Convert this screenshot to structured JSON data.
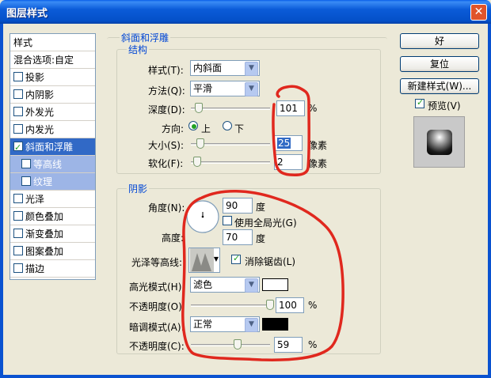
{
  "window": {
    "title": "图层样式",
    "close_glyph": "✕"
  },
  "sidebar": {
    "header": "样式",
    "items": [
      {
        "label": "混合选项:自定",
        "checkbox": false
      },
      {
        "label": "投影",
        "checkbox": true,
        "checked": false
      },
      {
        "label": "内阴影",
        "checkbox": true,
        "checked": false
      },
      {
        "label": "外发光",
        "checkbox": true,
        "checked": false
      },
      {
        "label": "内发光",
        "checkbox": true,
        "checked": false
      },
      {
        "label": "斜面和浮雕",
        "checkbox": true,
        "checked": true,
        "selected": true
      },
      {
        "label": "等高线",
        "checkbox": true,
        "checked": false,
        "sub": true
      },
      {
        "label": "纹理",
        "checkbox": true,
        "checked": false,
        "sub": true
      },
      {
        "label": "光泽",
        "checkbox": true,
        "checked": false
      },
      {
        "label": "颜色叠加",
        "checkbox": true,
        "checked": false
      },
      {
        "label": "渐变叠加",
        "checkbox": true,
        "checked": false
      },
      {
        "label": "图案叠加",
        "checkbox": true,
        "checked": false
      },
      {
        "label": "描边",
        "checkbox": true,
        "checked": false
      }
    ]
  },
  "bevel": {
    "title": "斜面和浮雕",
    "structure": {
      "title": "结构",
      "style_label": "样式(T):",
      "style_value": "内斜面",
      "technique_label": "方法(Q):",
      "technique_value": "平滑",
      "depth_label": "深度(D):",
      "depth_value": "101",
      "depth_unit": "%",
      "direction_label": "方向:",
      "dir_up": "上",
      "dir_down": "下",
      "size_label": "大小(S):",
      "size_value": "25",
      "size_unit": "像素",
      "soften_label": "软化(F):",
      "soften_value": "2",
      "soften_unit": "像素",
      "depth_level_pct": 10,
      "size_level_pct": 12,
      "soften_level_pct": 8
    },
    "shading": {
      "title": "阴影",
      "angle_label": "角度(N):",
      "angle_value": "90",
      "angle_unit": "度",
      "global_light_label": "使用全局光(G)",
      "altitude_label": "高度:",
      "altitude_value": "70",
      "altitude_unit": "度",
      "gloss_label": "光泽等高线:",
      "antialias_label": "消除锯齿(L)",
      "highlight_mode_label": "高光模式(H):",
      "highlight_mode_value": "滤色",
      "highlight_color": "#ffffff",
      "highlight_opacity_label": "不透明度(O):",
      "highlight_opacity_value": "100",
      "highlight_opacity_unit": "%",
      "shadow_mode_label": "暗调模式(A):",
      "shadow_mode_value": "正常",
      "shadow_color": "#000000",
      "shadow_opacity_label": "不透明度(C):",
      "shadow_opacity_value": "59",
      "shadow_opacity_unit": "%",
      "highlight_opacity_level_pct": 100,
      "shadow_opacity_level_pct": 59
    }
  },
  "buttons": {
    "ok": "好",
    "reset": "复位",
    "new_style": "新建样式(W)...",
    "preview": "预览(V)"
  },
  "accent": "#3169c6"
}
